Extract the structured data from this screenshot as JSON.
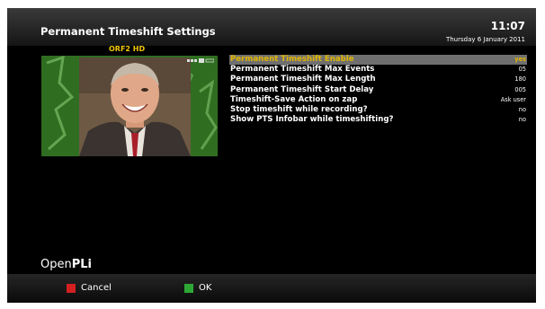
{
  "header": {
    "title": "Permanent Timeshift Settings",
    "time": "11:07",
    "date": "Thursday 6 January 2011"
  },
  "preview": {
    "channel": "ORF2 HD"
  },
  "settings": [
    {
      "label": "Permanent Timeshift Enable",
      "value": "yes",
      "selected": true
    },
    {
      "label": "Permanent Timeshift Max Events",
      "value": "05",
      "selected": false
    },
    {
      "label": "Permanent Timeshift Max Length",
      "value": "180",
      "selected": false
    },
    {
      "label": "Permanent Timeshift Start Delay",
      "value": "005",
      "selected": false
    },
    {
      "label": "Timeshift-Save Action on zap",
      "value": "Ask user",
      "selected": false
    },
    {
      "label": "Stop timeshift while recording?",
      "value": "no",
      "selected": false
    },
    {
      "label": "Show PTS Infobar while timeshifting?",
      "value": "no",
      "selected": false
    }
  ],
  "branding": {
    "logo_prefix": "Open",
    "logo_suffix": "PLi"
  },
  "footer": {
    "cancel_label": "Cancel",
    "ok_label": "OK"
  },
  "colors": {
    "highlight_text": "#e2b600",
    "channel_text": "#f2c700",
    "red_key": "#d22020",
    "green_key": "#2ea835"
  }
}
